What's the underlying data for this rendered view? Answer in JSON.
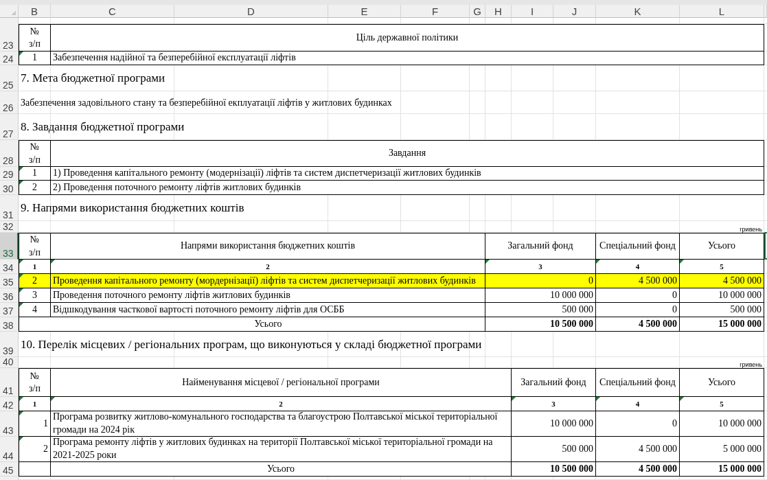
{
  "column_headers": [
    "B",
    "C",
    "D",
    "E",
    "F",
    "G",
    "H",
    "I",
    "J",
    "K",
    "L"
  ],
  "row_headers": [
    {
      "label": "23",
      "selected": false
    },
    {
      "label": "24",
      "selected": false
    },
    {
      "label": "25",
      "selected": false
    },
    {
      "label": "26",
      "selected": false
    },
    {
      "label": "27",
      "selected": false
    },
    {
      "label": "28",
      "selected": false
    },
    {
      "label": "29",
      "selected": false
    },
    {
      "label": "30",
      "selected": false
    },
    {
      "label": "31",
      "selected": false
    },
    {
      "label": "32",
      "selected": false
    },
    {
      "label": "33",
      "selected": true
    },
    {
      "label": "34",
      "selected": false
    },
    {
      "label": "35",
      "selected": false
    },
    {
      "label": "36",
      "selected": false
    },
    {
      "label": "37",
      "selected": false
    },
    {
      "label": "38",
      "selected": false
    },
    {
      "label": "39",
      "selected": false
    },
    {
      "label": "40",
      "selected": false
    },
    {
      "label": "41",
      "selected": false
    },
    {
      "label": "42",
      "selected": false
    },
    {
      "label": "43",
      "selected": false
    },
    {
      "label": "44",
      "selected": false
    },
    {
      "label": "45",
      "selected": false
    }
  ],
  "policy_table": {
    "number_header": "№\nз/п",
    "title_header": "Ціль державної політики",
    "rows": [
      {
        "number": "1",
        "text": "Забезпечення надійної та безперебійної експлуатації ліфтів",
        "flagged": true
      }
    ]
  },
  "goal_heading": "7. Мета бюджетної програми",
  "goal_text": "Забезпечення задовільного стану та безперебійної екплуатації ліфтів у житлових будинках",
  "tasks_heading": "8. Завдання бюджетної програми",
  "tasks_table": {
    "number_header": "№\nз/п",
    "title_header": "Завдання",
    "rows": [
      {
        "number": "1",
        "text": "1)  Проведення капітального ремонту (модернізації) ліфтів та систем диспетчеризації житлових будинків",
        "flagged": true
      },
      {
        "number": "2",
        "text": "2)  Проведення поточного ремонту ліфтів житлових будинків",
        "flagged": true
      }
    ]
  },
  "directions_heading": "9. Напрями використання бюджетних коштів",
  "directions_unit": "гривень",
  "directions_table": {
    "headers": [
      "№\nз/п",
      "Напрями використання бюджетних коштів",
      "Загальний фонд",
      "Спеціальний фонд",
      "Усього"
    ],
    "index_row": [
      {
        "text": "1",
        "flagged": true
      },
      {
        "text": "2",
        "flagged": true
      },
      {
        "text": "3",
        "flagged": true
      },
      {
        "text": "4",
        "flagged": true
      },
      {
        "text": "5",
        "flagged": true
      }
    ],
    "rows": [
      {
        "number": "2",
        "name": "Проведення капітального ремонту (мордернізації) ліфтів та систем диспетчеризації  житлових будинків",
        "general": "0",
        "special": "4 500 000",
        "total": "4 500 000",
        "flagged": true,
        "highlighted": true
      },
      {
        "number": "3",
        "name": "Проведення поточного ремонту ліфтів житлових будинків",
        "general": "10 000 000",
        "special": "0",
        "total": "10 000 000",
        "flagged": true,
        "highlighted": false
      },
      {
        "number": "4",
        "name": "Відшкодування часткової вартості поточного ремонту ліфтів для ОСББ",
        "general": "500 000",
        "special": "0",
        "total": "500 000",
        "flagged": true,
        "highlighted": false
      }
    ],
    "total": {
      "label": "Усього",
      "general": "10 500 000",
      "special": "4 500 000",
      "total": "15 000 000"
    }
  },
  "programs_heading": "10. Перелік місцевих / регіональних програм, що виконуються у складі бюджетної програми",
  "programs_unit": "гривень",
  "programs_table": {
    "headers": [
      "№\nз/п",
      "Найменування місцевої / регіональної програми",
      "Загальний фонд",
      "Спеціальний фонд",
      "Усього"
    ],
    "index_row": [
      {
        "text": "1",
        "flagged": true
      },
      {
        "text": "2",
        "flagged": true
      },
      {
        "text": "3",
        "flagged": true
      },
      {
        "text": "4",
        "flagged": true
      },
      {
        "text": "5",
        "flagged": true
      }
    ],
    "rows": [
      {
        "number": "1",
        "name": "Програма розвитку житлово-комунального господарства та благоустрою Полтавської міської територіальної громади на  2024 рік",
        "general": "10 000 000",
        "special": "0",
        "total": "10 000 000",
        "flagged": true,
        "highlighted": false
      },
      {
        "number": "2",
        "name": " Програма ремонту ліфтів у житлових будинках на території Полтавської міської територіальної громади на 2021-2025 роки",
        "general": "500 000",
        "special": "4 500 000",
        "total": "5 000 000",
        "flagged": true,
        "highlighted": false
      }
    ],
    "total": {
      "label": "Усього",
      "general": "10 500 000",
      "special": "4 500 000",
      "total": "15 000 000"
    }
  }
}
